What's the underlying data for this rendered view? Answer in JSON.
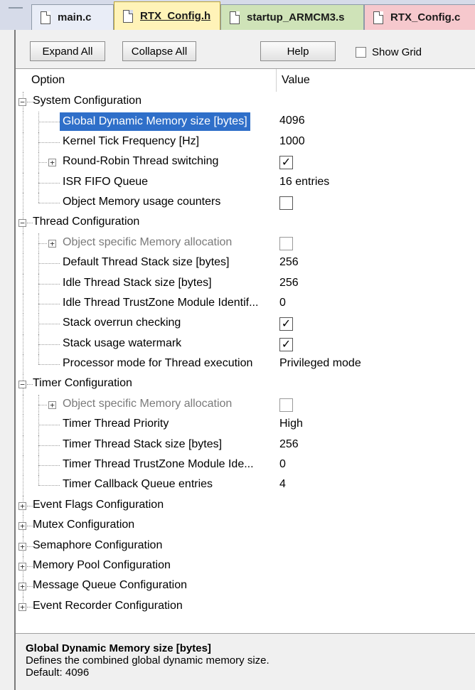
{
  "tabs": [
    {
      "label": "main.c"
    },
    {
      "label": "RTX_Config.h"
    },
    {
      "label": "startup_ARMCM3.s"
    },
    {
      "label": "RTX_Config.c"
    }
  ],
  "toolbar": {
    "expand_all": "Expand All",
    "collapse_all": "Collapse All",
    "help": "Help",
    "show_grid": "Show Grid",
    "show_grid_checked": false
  },
  "columns": {
    "option": "Option",
    "value": "Value"
  },
  "rows": [
    {
      "label": "System Configuration",
      "level": 0,
      "expander": "minus"
    },
    {
      "label": "Global Dynamic Memory size [bytes]",
      "value": "4096",
      "level": 1,
      "selected": true
    },
    {
      "label": "Kernel Tick Frequency [Hz]",
      "value": "1000",
      "level": 1
    },
    {
      "label": "Round-Robin Thread switching",
      "level": 1,
      "expander": "plus",
      "checkbox": true
    },
    {
      "label": "ISR FIFO Queue",
      "value": "16 entries",
      "level": 1
    },
    {
      "label": "Object Memory usage counters",
      "level": 1,
      "checkbox": false
    },
    {
      "label": "Thread Configuration",
      "level": 0,
      "expander": "minus"
    },
    {
      "label": "Object specific Memory allocation",
      "level": 1,
      "expander": "plus",
      "checkbox": false,
      "disabled": true
    },
    {
      "label": "Default Thread Stack size [bytes]",
      "value": "256",
      "level": 1
    },
    {
      "label": "Idle Thread Stack size [bytes]",
      "value": "256",
      "level": 1
    },
    {
      "label": "Idle Thread TrustZone Module Identif...",
      "value": "0",
      "level": 1
    },
    {
      "label": "Stack overrun checking",
      "level": 1,
      "checkbox": true
    },
    {
      "label": "Stack usage watermark",
      "level": 1,
      "checkbox": true
    },
    {
      "label": "Processor mode for Thread execution",
      "value": "Privileged mode",
      "level": 1
    },
    {
      "label": "Timer Configuration",
      "level": 0,
      "expander": "minus"
    },
    {
      "label": "Object specific Memory allocation",
      "level": 1,
      "expander": "plus",
      "checkbox": false,
      "disabled": true
    },
    {
      "label": "Timer Thread Priority",
      "value": "High",
      "level": 1
    },
    {
      "label": "Timer Thread Stack size [bytes]",
      "value": "256",
      "level": 1
    },
    {
      "label": "Timer Thread TrustZone Module Ide...",
      "value": "0",
      "level": 1
    },
    {
      "label": "Timer Callback Queue entries",
      "value": "4",
      "level": 1
    },
    {
      "label": "Event Flags Configuration",
      "level": 0,
      "expander": "plus"
    },
    {
      "label": "Mutex Configuration",
      "level": 0,
      "expander": "plus"
    },
    {
      "label": "Semaphore Configuration",
      "level": 0,
      "expander": "plus"
    },
    {
      "label": "Memory Pool Configuration",
      "level": 0,
      "expander": "plus"
    },
    {
      "label": "Message Queue Configuration",
      "level": 0,
      "expander": "plus"
    },
    {
      "label": "Event Recorder Configuration",
      "level": 0,
      "expander": "plus"
    }
  ],
  "description": {
    "title": "Global Dynamic Memory size [bytes]",
    "text": "Defines the combined global dynamic memory size.",
    "default": "Default: 4096"
  },
  "icons": {
    "tab_file": "document-icon",
    "expand": "plus-box-icon",
    "collapse": "minus-box-icon",
    "check": "checkmark-icon"
  },
  "colors": {
    "selection": "#2f6fc9",
    "active_tab": "#fff3b8",
    "startup_tab": "#cfe3b8",
    "rtxc_tab": "#f6c8cd"
  }
}
